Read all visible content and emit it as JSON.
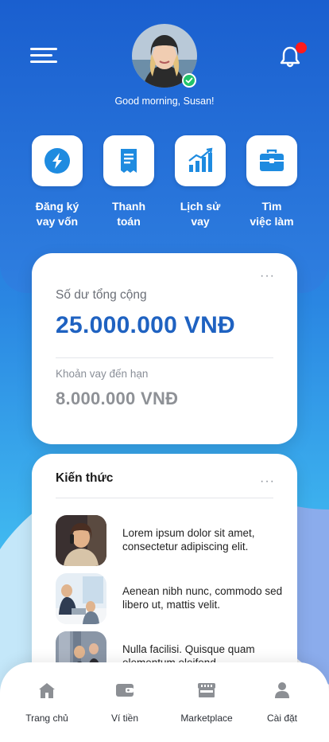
{
  "header": {
    "greeting": "Good morning, Susan!",
    "notification_badge": true,
    "online_status_color": "#22c36b"
  },
  "quick_actions": [
    {
      "label": "Đăng ký\nvay vốn",
      "icon": "loan-app-icon"
    },
    {
      "label": "Thanh\ntoán",
      "icon": "receipt-icon"
    },
    {
      "label": "Lịch sử\nvay",
      "icon": "chart-growth-icon"
    },
    {
      "label": "Tìm\nviệc làm",
      "icon": "briefcase-icon"
    }
  ],
  "balance_card": {
    "label": "Số dư tổng cộng",
    "value": "25.000.000 VNĐ",
    "due_label": "Khoản vay đến hạn",
    "due_value": "8.000.000 VNĐ",
    "menu": "···"
  },
  "knowledge": {
    "title": "Kiến thức",
    "menu": "···",
    "articles": [
      {
        "text": "Lorem ipsum dolor sit amet, consectetur adipiscing elit."
      },
      {
        "text": "Aenean nibh nunc, commodo sed libero ut, mattis velit."
      },
      {
        "text": "Nulla facilisi. Quisque quam elementum eleifend"
      }
    ]
  },
  "bottom_nav": [
    {
      "label": "Trang chủ",
      "icon": "home-icon"
    },
    {
      "label": "Ví tiền",
      "icon": "wallet-icon"
    },
    {
      "label": "Marketplace",
      "icon": "store-icon"
    },
    {
      "label": "Cài đặt",
      "icon": "user-icon"
    }
  ],
  "colors": {
    "brand_blue": "#1f62c1",
    "gradient_top": "#1b63d3",
    "gradient_bottom": "#3fb5f0",
    "icon_blue": "#1e8be0"
  }
}
